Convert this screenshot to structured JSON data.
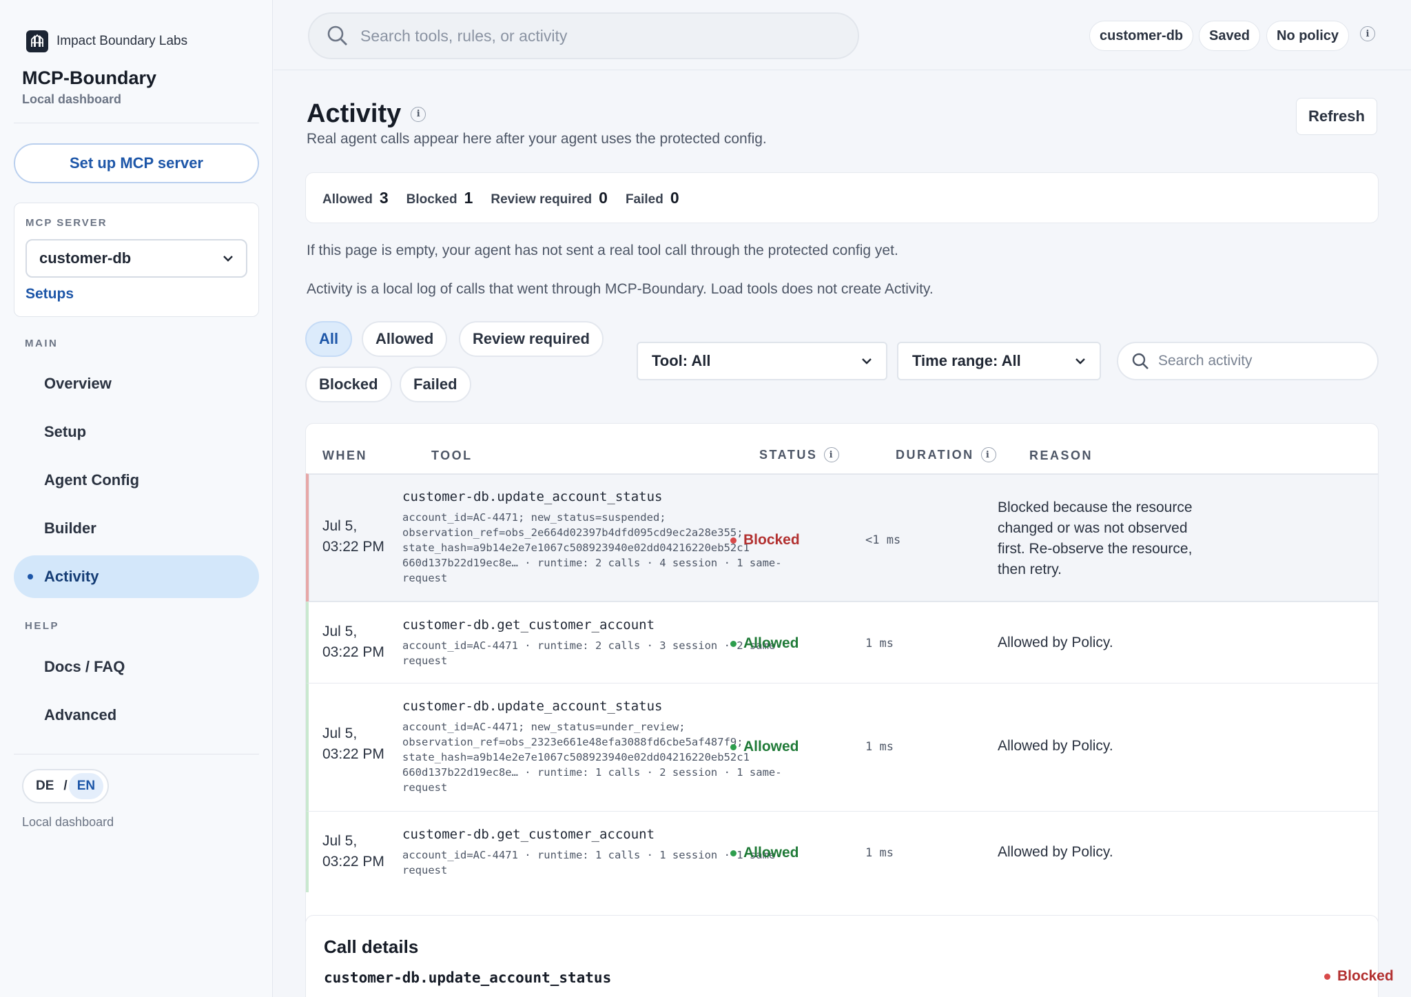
{
  "brand": {
    "org": "Impact Boundary Labs",
    "app_title": "MCP-Boundary",
    "app_sub": "Local dashboard"
  },
  "sidebar": {
    "setup_button": "Set up MCP server",
    "server_label": "MCP SERVER",
    "server_selected": "customer-db",
    "setups_link": "Setups",
    "main_label": "MAIN",
    "help_label": "HELP",
    "main_items": [
      {
        "label": "Overview"
      },
      {
        "label": "Setup"
      },
      {
        "label": "Agent Config"
      },
      {
        "label": "Builder"
      },
      {
        "label": "Activity"
      }
    ],
    "help_items": [
      {
        "label": "Docs / FAQ"
      },
      {
        "label": "Advanced"
      }
    ],
    "lang": {
      "de": "DE",
      "sep": "/",
      "en": "EN"
    },
    "footer": "Local dashboard"
  },
  "topbar": {
    "search_placeholder": "Search tools, rules, or activity",
    "pills": [
      "customer-db",
      "Saved",
      "No policy"
    ],
    "info": "i"
  },
  "page": {
    "title": "Activity",
    "subtitle": "Real agent calls appear here after your agent uses the protected config.",
    "refresh": "Refresh",
    "counts": [
      {
        "label": "Allowed",
        "value": "3"
      },
      {
        "label": "Blocked",
        "value": "1"
      },
      {
        "label": "Review required",
        "value": "0"
      },
      {
        "label": "Failed",
        "value": "0"
      }
    ],
    "note1": "If this page is empty, your agent has not sent a real tool call through the protected config yet.",
    "note2": "Activity is a local log of calls that went through MCP-Boundary. Load tools does not create Activity.",
    "filters": [
      "All",
      "Allowed",
      "Review required",
      "Blocked",
      "Failed"
    ],
    "tool_select": "Tool: All",
    "time_select": "Time range: All",
    "search_activity": "Search activity"
  },
  "table": {
    "headers": {
      "when": "WHEN",
      "tool": "TOOL",
      "status": "STATUS",
      "duration": "DURATION",
      "reason": "REASON"
    },
    "rows": [
      {
        "when_date": "Jul 5,",
        "when_time": "03:22 PM",
        "tool": "customer-db.update_account_status",
        "args": "account_id=AC-4471; new_status=suspended; observation_ref=obs_2e664d02397b4dfd095cd9ec2a28e355; state_hash=a9b14e2e7e1067c508923940e02dd04216220eb52c1 660d137b22d19ec8e… · runtime: 2 calls · 4 session · 1 same-request",
        "status": "Blocked",
        "duration": "<1 ms",
        "reason": "Blocked because the resource changed or was not observed first. Re-observe the resource, then retry."
      },
      {
        "when_date": "Jul 5,",
        "when_time": "03:22 PM",
        "tool": "customer-db.get_customer_account",
        "args": "account_id=AC-4471 · runtime: 2 calls · 3 session · 2 same-request",
        "status": "Allowed",
        "duration": "1 ms",
        "reason": "Allowed by Policy."
      },
      {
        "when_date": "Jul 5,",
        "when_time": "03:22 PM",
        "tool": "customer-db.update_account_status",
        "args": "account_id=AC-4471; new_status=under_review; observation_ref=obs_2323e661e48efa3088fd6cbe5af487f9; state_hash=a9b14e2e7e1067c508923940e02dd04216220eb52c1 660d137b22d19ec8e… · runtime: 1 calls · 2 session · 1 same-request",
        "status": "Allowed",
        "duration": "1 ms",
        "reason": "Allowed by Policy."
      },
      {
        "when_date": "Jul 5,",
        "when_time": "03:22 PM",
        "tool": "customer-db.get_customer_account",
        "args": "account_id=AC-4471 · runtime: 1 calls · 1 session · 1 same-request",
        "status": "Allowed",
        "duration": "1 ms",
        "reason": "Allowed by Policy."
      }
    ]
  },
  "details": {
    "title": "Call details",
    "tool": "customer-db.update_account_status",
    "status": "Blocked"
  },
  "colors": {
    "accent": "#1d56a8",
    "blocked": "#b23030",
    "allowed": "#1f7a37",
    "active_nav": "#d3e7fa"
  }
}
